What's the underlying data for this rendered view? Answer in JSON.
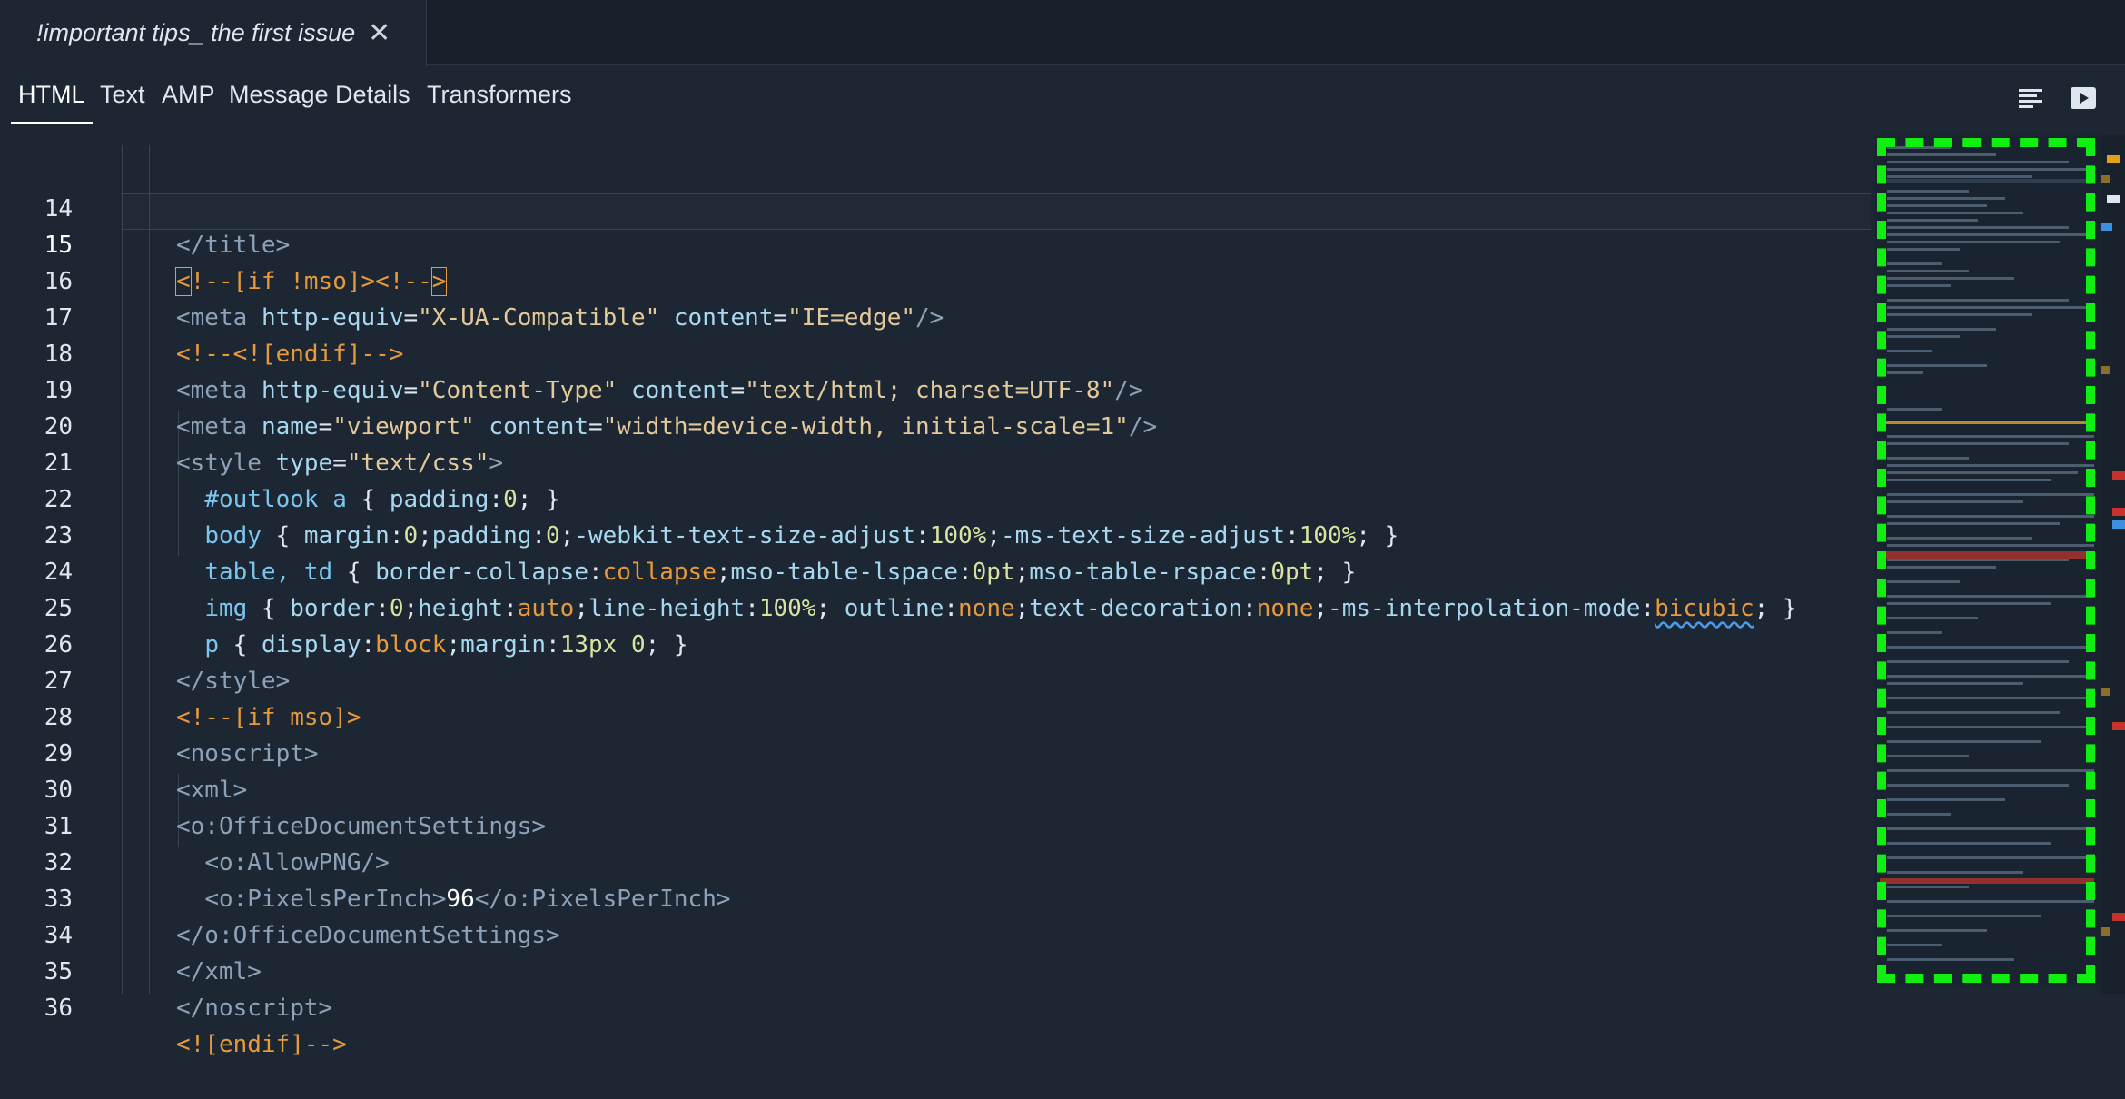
{
  "file_tab": {
    "title": "!important tips_ the first issue",
    "close_icon": "close-icon"
  },
  "view_tabs": {
    "items": [
      "HTML",
      "Text",
      "AMP",
      "Message Details",
      "Transformers"
    ],
    "active": "HTML"
  },
  "toolbar": {
    "wrap_icon": "text-wrap-icon",
    "preview_icon": "play-preview-icon"
  },
  "editor": {
    "current_line": "15",
    "line_numbers": [
      "14",
      "15",
      "16",
      "17",
      "18",
      "19",
      "20",
      "21",
      "22",
      "23",
      "24",
      "25",
      "26",
      "27",
      "28",
      "29",
      "30",
      "31",
      "32",
      "33",
      "34",
      "35",
      "36"
    ]
  },
  "colors": {
    "background": "#1d2733",
    "tag": "#8da2b8",
    "attribute": "#a8d8f0",
    "string": "#e3c89a",
    "comment": "#e69a3c",
    "minimap_highlight": "#11ee11"
  }
}
